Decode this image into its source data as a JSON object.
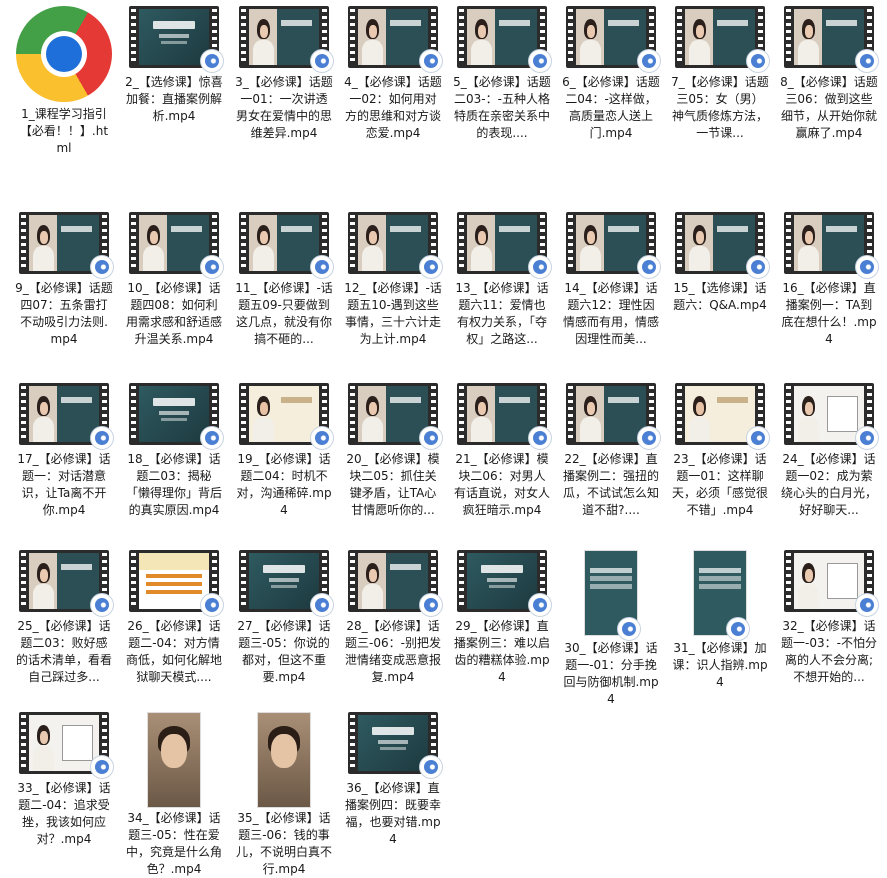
{
  "files": [
    {
      "label": "1_课程学习指引【必看！！】.html",
      "kind": "chrome"
    },
    {
      "label": "2_【选修课】惊喜加餐：直播案例解析.mp4",
      "kind": "slide"
    },
    {
      "label": "3_【必修课】话题一01：一次讲透男女在爱情中的思维差异.mp4",
      "kind": "person"
    },
    {
      "label": "4_【必修课】话题一02：如何用对方的思维和对方谈恋爱.mp4",
      "kind": "person"
    },
    {
      "label": "5_【必修课】话题二03-：-五种人格特质在亲密关系中的表现....",
      "kind": "person"
    },
    {
      "label": "6_【必修课】话题二04：-这样做，高质量恋人送上门.mp4",
      "kind": "person"
    },
    {
      "label": "7_【必修课】话题三05：女（男）神气质修炼方法，一节课...",
      "kind": "person"
    },
    {
      "label": "8_【必修课】话题三06：做到这些细节，从开始你就赢麻了.mp4",
      "kind": "person"
    },
    {
      "label": "9_【必修课】话题四07：五条雷打不动吸引力法则.mp4",
      "kind": "person"
    },
    {
      "label": "10_【必修课】话题四08：如何利用需求感和舒适感升温关系.mp4",
      "kind": "person"
    },
    {
      "label": "11_【必修课】-话题五09-只要做到这几点，就没有你搞不砸的...",
      "kind": "person"
    },
    {
      "label": "12_【必修课】-话题五10-遇到这些事情，三十六计走为上计.mp4",
      "kind": "person"
    },
    {
      "label": "13_【必修课】话题六11：爱情也有权力关系，「夺权」之路这...",
      "kind": "person"
    },
    {
      "label": "14_【必修课】话题六12：理性因情感而有用，情感因理性而美...",
      "kind": "person"
    },
    {
      "label": "15_【选修课】话题六：Q&A.mp4",
      "kind": "person"
    },
    {
      "label": "16_【必修课】直播案例一：TA到底在想什么！.mp4",
      "kind": "person"
    },
    {
      "label": "17_【必修课】话题一：对话潜意识，让Ta离不开你.mp4",
      "kind": "person"
    },
    {
      "label": "18_【必修课】话题二03：揭秘「懒得理你」背后的真实原因.mp4",
      "kind": "slide"
    },
    {
      "label": "19_【必修课】话题二04：时机不对，沟通稀碎.mp4",
      "kind": "cream"
    },
    {
      "label": "20_【必修课】模块二05：抓住关键矛盾，让TA心甘情愿听你的...",
      "kind": "person"
    },
    {
      "label": "21_【必修课】模块二06：对男人有话直说，对女人疯狂暗示.mp4",
      "kind": "person"
    },
    {
      "label": "22_【必修课】直播案例二：强扭的瓜，不试试怎么知道不甜?....",
      "kind": "person"
    },
    {
      "label": "23_【必修课】话题一01：这样聊天，必须「感觉很不错」.mp4",
      "kind": "cream"
    },
    {
      "label": "24_【必修课】话题一02：成为萦绕心头的白月光，好好聊天...",
      "kind": "board"
    },
    {
      "label": "25_【必修课】话题二03：败好感的话术清单，看看自己踩过多...",
      "kind": "person"
    },
    {
      "label": "26_【必修课】话题二-04：对方情商低，如何化解地狱聊天模式....",
      "kind": "orange"
    },
    {
      "label": "27_【必修课】话题三-05：你说的都对，但这不重要.mp4",
      "kind": "slide"
    },
    {
      "label": "28_【必修课】话题三-06：-别把发泄情绪变成恶意报复.mp4",
      "kind": "person"
    },
    {
      "label": "29_【必修课】直播案例三：难以启齿的糟糕体验.mp4",
      "kind": "slide"
    },
    {
      "label": "30_【必修课】话题一-01：分手挽回与防御机制.mp4",
      "kind": "vertical"
    },
    {
      "label": "31_【必修课】加课：识人指辨.mp4",
      "kind": "vertical"
    },
    {
      "label": "32_【必修课】话题一-03：-不怕分离的人不会分离;不想开始的...",
      "kind": "board"
    },
    {
      "label": "33_【必修课】话题二-04：追求受挫，我该如何应对？.mp4",
      "kind": "board"
    },
    {
      "label": "34_【必修课】话题三-05：性在爱中，究竟是什么角色？.mp4",
      "kind": "selfie"
    },
    {
      "label": "35_【必修课】话题三-06：钱的事儿，不说明白真不行.mp4",
      "kind": "selfie"
    },
    {
      "label": "36_【必修课】直播案例四：既要幸福，也要对错.mp4",
      "kind": "slide"
    }
  ]
}
